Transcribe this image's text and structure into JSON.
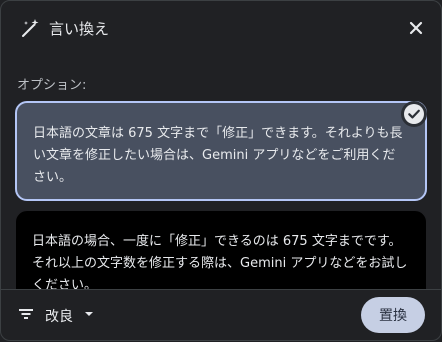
{
  "header": {
    "title": "言い換え"
  },
  "options_label": "オプション:",
  "options": [
    {
      "text": "日本語の文章は 675 文字まで「修正」できます。それよりも長い文章を修正したい場合は、Gemini アプリなどをご利用ください。",
      "selected": true
    },
    {
      "text": "日本語の場合、一度に「修正」できるのは 675 文字までです。それ以上の文字数を修正する際は、Gemini アプリなどをお試しください。",
      "selected": false
    }
  ],
  "footer": {
    "sort_label": "改良",
    "replace_label": "置換"
  },
  "icons": {
    "title": "magic-wand-icon",
    "close": "close-icon",
    "check": "check-circle-icon",
    "sort": "filter-list-icon",
    "dropdown": "arrow-drop-down-icon"
  },
  "colors": {
    "accent": "#b4c6f6",
    "selected_bg": "#485060",
    "button_bg": "#c6cfe4"
  }
}
